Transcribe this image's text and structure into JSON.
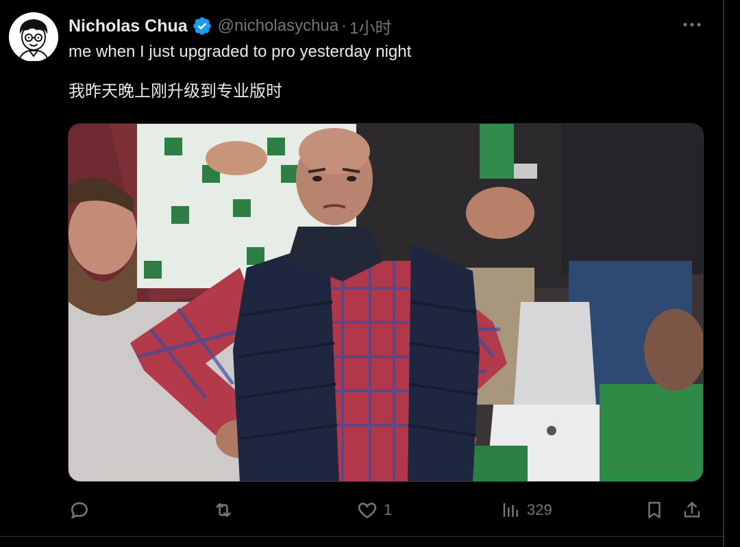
{
  "tweet": {
    "author": {
      "display_name": "Nicholas Chua",
      "handle": "@nicholasychua",
      "verified": true,
      "avatar_icon": "cartoon-face-avatar"
    },
    "separator": "·",
    "time": "1小时",
    "text_lines": [
      "me when I just upgraded to pro yesterday night",
      "我昨天晚上刚升级到专业版时"
    ],
    "media": {
      "kind": "photo",
      "description_icon": "photo"
    },
    "actions": {
      "reply": {
        "icon": "reply-icon",
        "count": ""
      },
      "retweet": {
        "icon": "retweet-icon",
        "count": ""
      },
      "like": {
        "icon": "heart-icon",
        "count": "1"
      },
      "views": {
        "icon": "bar-chart-icon",
        "count": "329"
      },
      "bookmark": {
        "icon": "bookmark-icon"
      },
      "share": {
        "icon": "share-icon"
      }
    }
  },
  "colors": {
    "background": "#000000",
    "text_primary": "#e7e9ea",
    "text_secondary": "#71767b",
    "verified_blue": "#1d9bf0",
    "divider": "#2f3336"
  }
}
